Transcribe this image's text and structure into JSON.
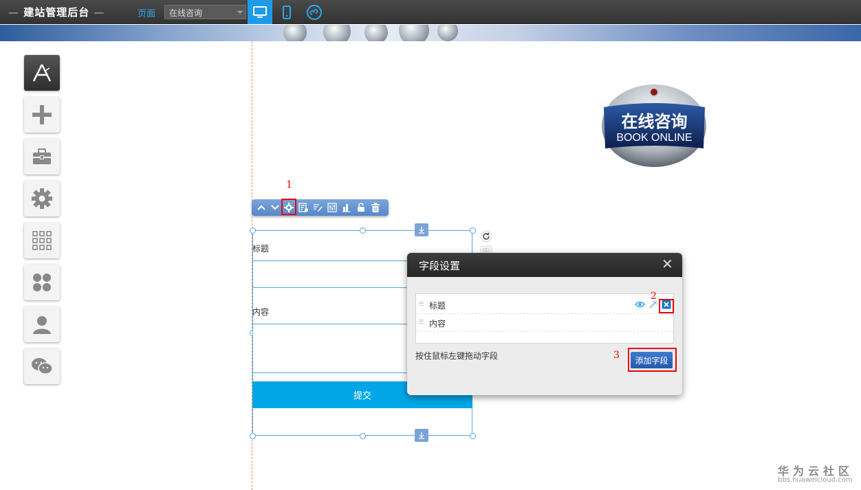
{
  "header": {
    "title": "建站管理后台",
    "page_label": "页面",
    "page_select_value": "在线咨询",
    "devices": [
      {
        "name": "desktop-icon",
        "active": true
      },
      {
        "name": "mobile-icon",
        "active": false
      },
      {
        "name": "mini-program-icon",
        "active": false
      }
    ]
  },
  "sidebar": {
    "items": [
      {
        "name": "app-store-icon"
      },
      {
        "name": "plus-icon"
      },
      {
        "name": "toolbox-icon"
      },
      {
        "name": "gear-icon"
      },
      {
        "name": "grid-icon"
      },
      {
        "name": "clover-icon"
      },
      {
        "name": "user-icon"
      },
      {
        "name": "wechat-icon"
      }
    ]
  },
  "badge": {
    "title": "在线咨询",
    "subtitle": "BOOK ONLINE"
  },
  "annotations": {
    "step1": "1",
    "step2": "2",
    "step3": "3"
  },
  "form": {
    "field1_label": "标题",
    "field2_label": "内容",
    "submit_label": "提交"
  },
  "dialog": {
    "title": "字段设置",
    "close_glyph": "✕",
    "fields": [
      "标题",
      "内容"
    ],
    "hint": "按住鼠标左键拖动字段",
    "add_button": "添加字段"
  },
  "watermark": {
    "main": "华为云社区",
    "sub": "bbs.huaweicloud.com"
  },
  "colors": {
    "accent": "#1e9be8",
    "submit": "#00a6e6",
    "annotation": "#ee0000"
  }
}
